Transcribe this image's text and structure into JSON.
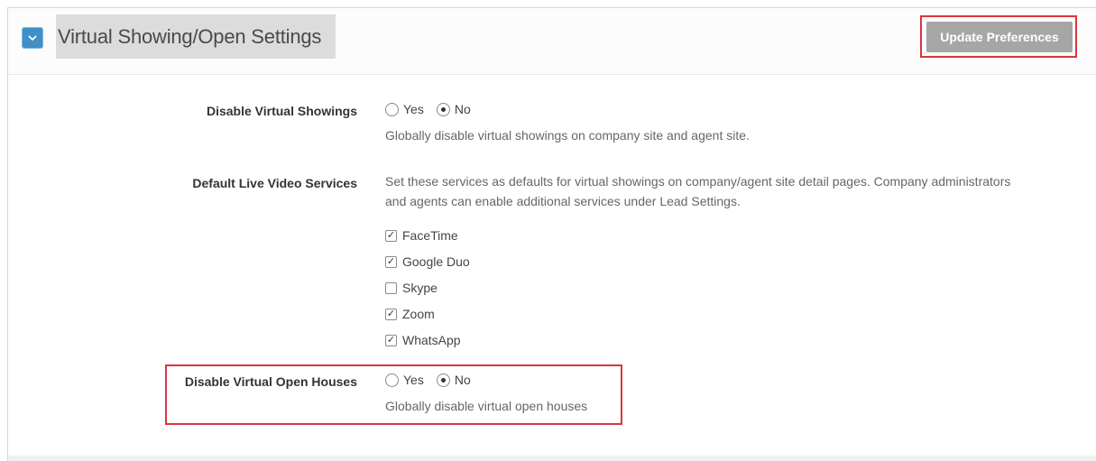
{
  "header": {
    "title": "Virtual Showing/Open Settings",
    "update_button": "Update Preferences"
  },
  "disable_virtual_showings": {
    "label": "Disable Virtual Showings",
    "options": [
      {
        "label": "Yes",
        "checked": false
      },
      {
        "label": "No",
        "checked": true
      }
    ],
    "help": "Globally disable virtual showings on company site and agent site."
  },
  "default_live_video": {
    "label": "Default Live Video Services",
    "help_line1": "Set these services as defaults for virtual showings on company/agent site detail pages. Company administrators",
    "help_line2": "and agents can enable additional services under Lead Settings.",
    "services": [
      {
        "label": "FaceTime",
        "checked": true
      },
      {
        "label": "Google Duo",
        "checked": true
      },
      {
        "label": "Skype",
        "checked": false
      },
      {
        "label": "Zoom",
        "checked": true
      },
      {
        "label": "WhatsApp",
        "checked": true
      }
    ]
  },
  "disable_virtual_open_houses": {
    "label": "Disable Virtual Open Houses",
    "options": [
      {
        "label": "Yes",
        "checked": false
      },
      {
        "label": "No",
        "checked": true
      }
    ],
    "help": "Globally disable virtual open houses"
  },
  "colors": {
    "accent_blue": "#3f8fc9",
    "highlight_red": "#d9363e",
    "button_gray": "#a6a6a6"
  }
}
